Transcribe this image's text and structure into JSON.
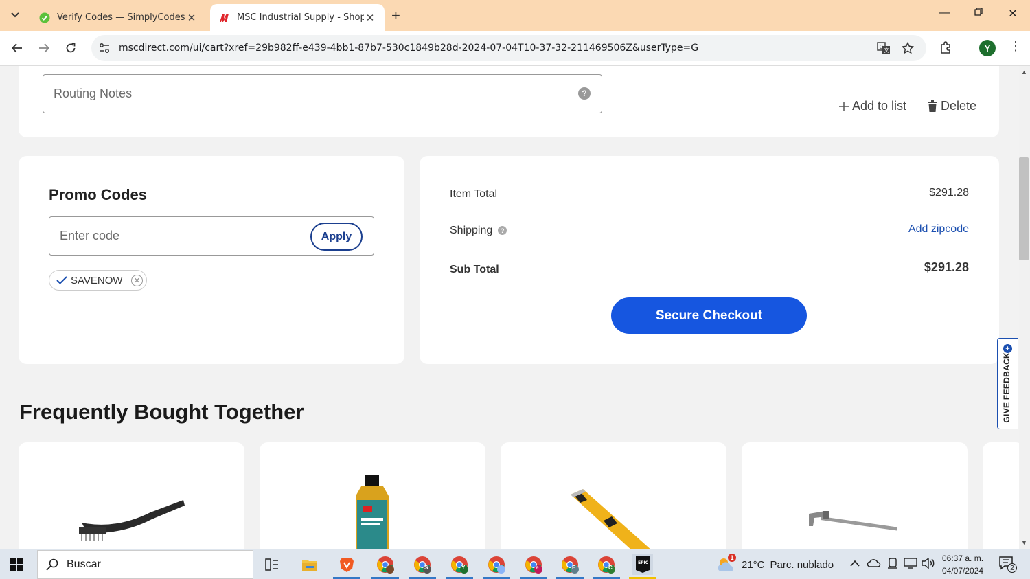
{
  "browser": {
    "tabs": [
      {
        "title": "Verify Codes — SimplyCodes",
        "active": false,
        "icon": "simplycodes-favicon"
      },
      {
        "title": "MSC Industrial Supply - Shoppi",
        "active": true,
        "icon": "msc-favicon"
      }
    ],
    "url": "mscdirect.com/ui/cart?xref=29b982ff-e439-4bb1-87b7-530c1849b28d-2024-07-04T10-37-32-211469506Z&userType=G",
    "profile_initial": "Y",
    "new_tab_symbol": "+"
  },
  "routing": {
    "placeholder": "Routing Notes",
    "help_symbol": "?",
    "add_to_list": "Add to list",
    "delete": "Delete"
  },
  "promo": {
    "title": "Promo Codes",
    "placeholder": "Enter code",
    "apply_label": "Apply",
    "applied_code": "SAVENOW"
  },
  "summary": {
    "item_total_label": "Item Total",
    "item_total_value": "$291.28",
    "shipping_label": "Shipping",
    "shipping_value": "Add zipcode",
    "subtotal_label": "Sub Total",
    "subtotal_value": "$291.28",
    "checkout_label": "Secure Checkout",
    "info_symbol": "?"
  },
  "frequently_bought": {
    "heading": "Frequently Bought Together",
    "products": [
      {
        "icon": "wire-brush-image"
      },
      {
        "icon": "cutting-fluid-bottle-image"
      },
      {
        "icon": "utility-knife-image"
      },
      {
        "icon": "pipe-wrench-image"
      }
    ]
  },
  "feedback": {
    "label": "GIVE FEEDBACK",
    "plus": "+"
  },
  "taskbar": {
    "search_label": "Buscar",
    "weather_temp": "21°C",
    "weather_desc": "Parc. nublado",
    "weather_alert": "1",
    "time": "06:37 a. m.",
    "date": "04/07/2024",
    "notification_count": "2",
    "chrome_profile_letters": [
      "S",
      "Y",
      "e",
      "E",
      "C"
    ]
  },
  "colors": {
    "tabbar": "#fbd9b3",
    "checkout_button": "#1656e0",
    "link": "#1b4fb0",
    "page_bg": "#f2f2f2"
  }
}
